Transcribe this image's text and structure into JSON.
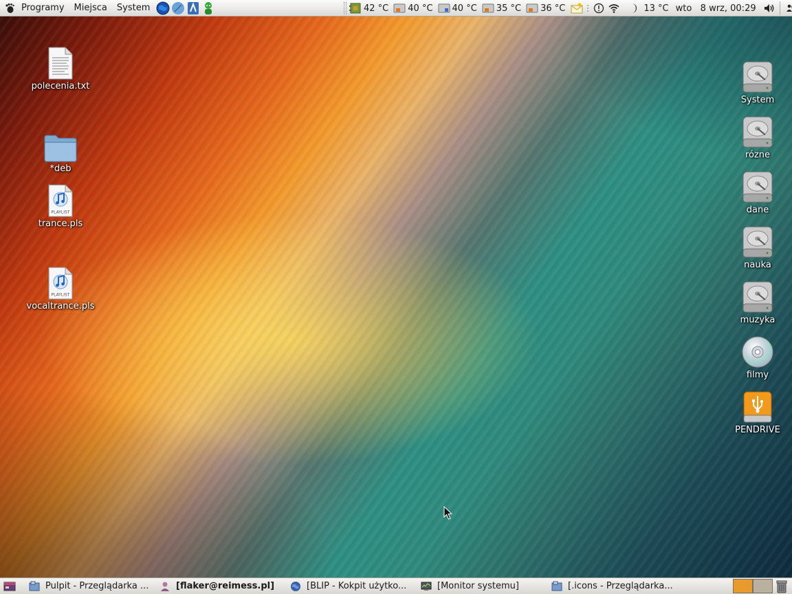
{
  "top_panel": {
    "menus": [
      "Programy",
      "Miejsca",
      "System"
    ],
    "launchers": [
      {
        "icon": "globe-browser-icon"
      },
      {
        "icon": "compass-browser-icon"
      },
      {
        "icon": "text-editor-icon"
      },
      {
        "icon": "messenger-icon"
      }
    ],
    "sensors": [
      {
        "icon": "cpu-sensor-icon",
        "value": "42 °C"
      },
      {
        "icon": "disk-sensor-icon",
        "value": "40 °C"
      },
      {
        "icon": "disk-sensor-icon",
        "value": "40 °C"
      },
      {
        "icon": "disk-sensor-icon",
        "value": "35 °C"
      },
      {
        "icon": "disk-sensor-icon",
        "value": "36 °C"
      }
    ],
    "weather_temp": "13 °C",
    "clock": "wto   8 wrz, 00:29"
  },
  "desktop": {
    "left_icons": [
      {
        "label": "polecenia.txt",
        "icon": "text-file-icon"
      },
      {
        "label": "*deb",
        "icon": "folder-icon"
      },
      {
        "label": "trance.pls",
        "icon": "playlist-file-icon",
        "badge": "PLAYLIST"
      },
      {
        "label": "vocaltrance.pls",
        "icon": "playlist-file-icon",
        "badge": "PLAYLIST"
      }
    ],
    "right_icons": [
      {
        "label": "System",
        "icon": "hard-drive-icon"
      },
      {
        "label": "rózne",
        "icon": "hard-drive-icon"
      },
      {
        "label": "dane",
        "icon": "hard-drive-icon"
      },
      {
        "label": "nauka",
        "icon": "hard-drive-icon"
      },
      {
        "label": "muzyka",
        "icon": "hard-drive-icon"
      },
      {
        "label": "filmy",
        "icon": "optical-disc-icon"
      },
      {
        "label": "PENDRIVE",
        "icon": "usb-drive-icon"
      }
    ]
  },
  "taskbar": {
    "tasks": [
      {
        "label": "Pulpit - Przeglądarka ...",
        "icon": "file-manager-icon",
        "active": false
      },
      {
        "label": "[flaker@reimess.pl]",
        "icon": "chat-user-icon",
        "active": true
      },
      {
        "label": "[BLIP - Kokpit użytko...",
        "icon": "browser-globe-icon",
        "active": false
      },
      {
        "label": "[Monitor systemu]",
        "icon": "system-monitor-icon",
        "active": false
      },
      {
        "label": "[.icons - Przeglądarka...",
        "icon": "file-manager-icon",
        "active": false
      }
    ],
    "workspace_colors": [
      "#e89a2c",
      "#b9b0a0"
    ]
  },
  "colors": {
    "panel_bg": "#e9e8e4",
    "accent_orange": "#f0902a",
    "accent_teal": "#2f8a7d"
  }
}
